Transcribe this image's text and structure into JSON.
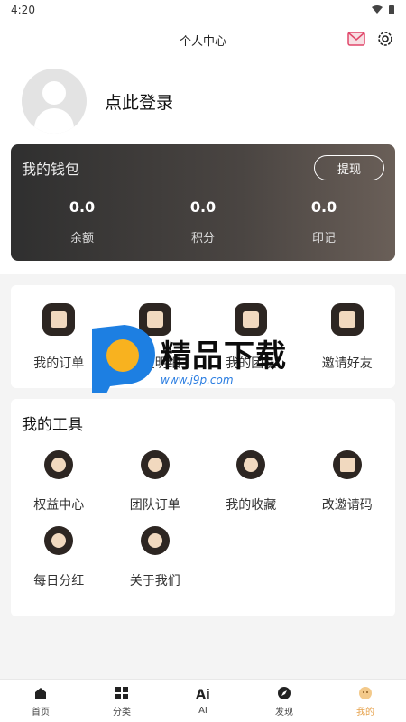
{
  "status": {
    "time": "4:20"
  },
  "header": {
    "title": "个人中心",
    "icons": [
      "mail-icon",
      "gear-icon"
    ]
  },
  "profile": {
    "login_text": "点此登录"
  },
  "wallet": {
    "title": "我的钱包",
    "withdraw": "提现",
    "stats": [
      {
        "value": "0.0",
        "label": "余额"
      },
      {
        "value": "0.0",
        "label": "积分"
      },
      {
        "value": "0.0",
        "label": "印记"
      }
    ]
  },
  "orders": {
    "items": [
      {
        "label": "我的订单",
        "icon": "clipboard-icon"
      },
      {
        "label": "收支明细",
        "icon": "yuan-icon"
      },
      {
        "label": "我的团队",
        "icon": "team-icon"
      },
      {
        "label": "邀请好友",
        "icon": "invite-icon"
      }
    ]
  },
  "tools": {
    "title": "我的工具",
    "row1": [
      {
        "label": "权益中心",
        "icon": "rights-icon"
      },
      {
        "label": "团队订单",
        "icon": "team-order-icon"
      },
      {
        "label": "我的收藏",
        "icon": "favorite-icon"
      },
      {
        "label": "改邀请码",
        "icon": "qr-icon"
      }
    ],
    "row2": [
      {
        "label": "每日分红",
        "icon": "moneybag-icon"
      },
      {
        "label": "关于我们",
        "icon": "about-icon"
      }
    ]
  },
  "watermark": {
    "title": "精品下载",
    "url": "www.j9p.com"
  },
  "tabbar": [
    {
      "label": "首页",
      "icon": "home-icon"
    },
    {
      "label": "分类",
      "icon": "grid-icon"
    },
    {
      "label": "AI",
      "icon": "ai-icon"
    },
    {
      "label": "发现",
      "icon": "compass-icon"
    },
    {
      "label": "我的",
      "icon": "me-icon",
      "active": true
    }
  ],
  "colors": {
    "accent": "#e6a24c",
    "wallet_dark": "#2f2f2f",
    "icon_dark": "#2d2622"
  }
}
